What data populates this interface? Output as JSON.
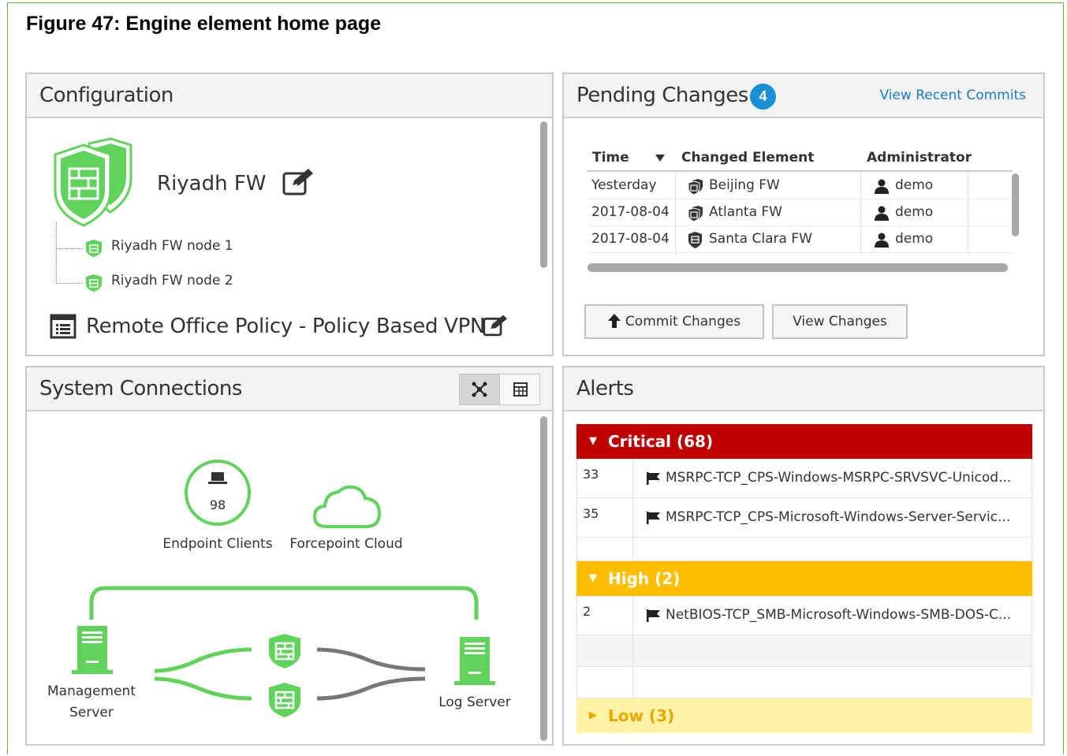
{
  "figure_title": "Figure 47: Engine element home page",
  "colors": {
    "brand_green": "#5fd35a",
    "critical": "#c00000",
    "high": "#ffbf00",
    "low_bg": "#fff3a6",
    "link": "#1a7dc4"
  },
  "configuration": {
    "title": "Configuration",
    "engine_name": "Riyadh FW",
    "nodes": [
      "Riyadh FW node 1",
      "Riyadh FW node 2"
    ],
    "policy": "Remote Office Policy - Policy Based VPN"
  },
  "pending": {
    "title": "Pending Changes",
    "count": "4",
    "link": "View Recent Commits",
    "columns": [
      "Time",
      "Changed Element",
      "Administrator"
    ],
    "rows": [
      {
        "time": "Yesterday",
        "element": "Beijing FW",
        "admin": "demo"
      },
      {
        "time": "2017-08-04",
        "element": "Atlanta FW",
        "admin": "demo"
      },
      {
        "time": "2017-08-04",
        "element": "Santa Clara FW",
        "admin": "demo"
      }
    ],
    "commit_button": "Commit Changes",
    "view_button": "View Changes"
  },
  "system": {
    "title": "System Connections",
    "endpoint_count": "98",
    "endpoint_label": "Endpoint Clients",
    "cloud_label": "Forcepoint Cloud",
    "mgmt_label_1": "Management",
    "mgmt_label_2": "Server",
    "log_label": "Log Server"
  },
  "alerts": {
    "title": "Alerts",
    "critical": {
      "label": "Critical (68)",
      "items": [
        {
          "count": "33",
          "name": "MSRPC-TCP_CPS-Windows-MSRPC-SRVSVC-Unicod..."
        },
        {
          "count": "35",
          "name": "MSRPC-TCP_CPS-Microsoft-Windows-Server-Servic..."
        }
      ]
    },
    "high": {
      "label": "High (2)",
      "items": [
        {
          "count": "2",
          "name": "NetBIOS-TCP_SMB-Microsoft-Windows-SMB-DOS-C..."
        }
      ]
    },
    "low": {
      "label": "Low (3)"
    }
  }
}
